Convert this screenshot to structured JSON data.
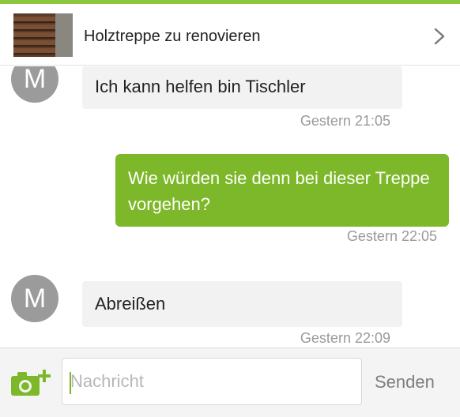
{
  "accent_color": "#8cc63f",
  "header": {
    "title": "Holztreppe zu renovieren",
    "thumbnail_icon": "staircase-photo",
    "chevron_icon": "chevron-right"
  },
  "messages": [
    {
      "direction": "incoming",
      "avatar_letter": "M",
      "text": "Ich kann helfen bin Tischler",
      "time": "Gestern 21:05"
    },
    {
      "direction": "outgoing",
      "text": "Wie würden sie denn bei dieser Treppe vorgehen?",
      "time": "Gestern 22:05"
    },
    {
      "direction": "incoming",
      "avatar_letter": "M",
      "text": "Abreißen",
      "time": "Gestern 22:09"
    }
  ],
  "composer": {
    "placeholder": "Nachricht",
    "send_label": "Senden",
    "camera_icon": "add-photo-camera"
  },
  "colors": {
    "outgoing_bubble": "#7cb829",
    "incoming_bubble": "#f2f2f2",
    "avatar": "#9b9b9b"
  }
}
